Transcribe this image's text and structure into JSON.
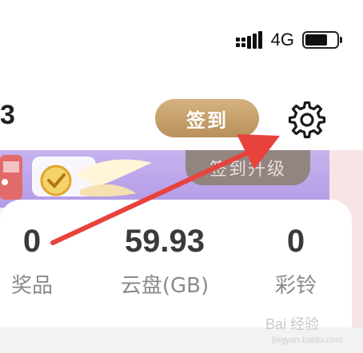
{
  "status_bar": {
    "network": "4G",
    "battery_level": 0.7,
    "icons": [
      "signal-bars-icon",
      "battery-icon"
    ]
  },
  "header": {
    "user_id_tail": "3",
    "checkin_label": "签到",
    "settings_icon": "gear-icon"
  },
  "banner": {
    "button_label": "签到升级"
  },
  "stats": [
    {
      "value": "0",
      "label": "奖品"
    },
    {
      "value": "59.93",
      "label": "云盘(GB)"
    },
    {
      "value": "0",
      "label": "彩铃"
    }
  ],
  "watermark": {
    "text": "Bai 经验",
    "sub": "jingyan.baidu.com"
  },
  "colors": {
    "checkin_button": "#c8a46e",
    "banner": "#c0aaec",
    "annotation_arrow": "#e8423c"
  }
}
